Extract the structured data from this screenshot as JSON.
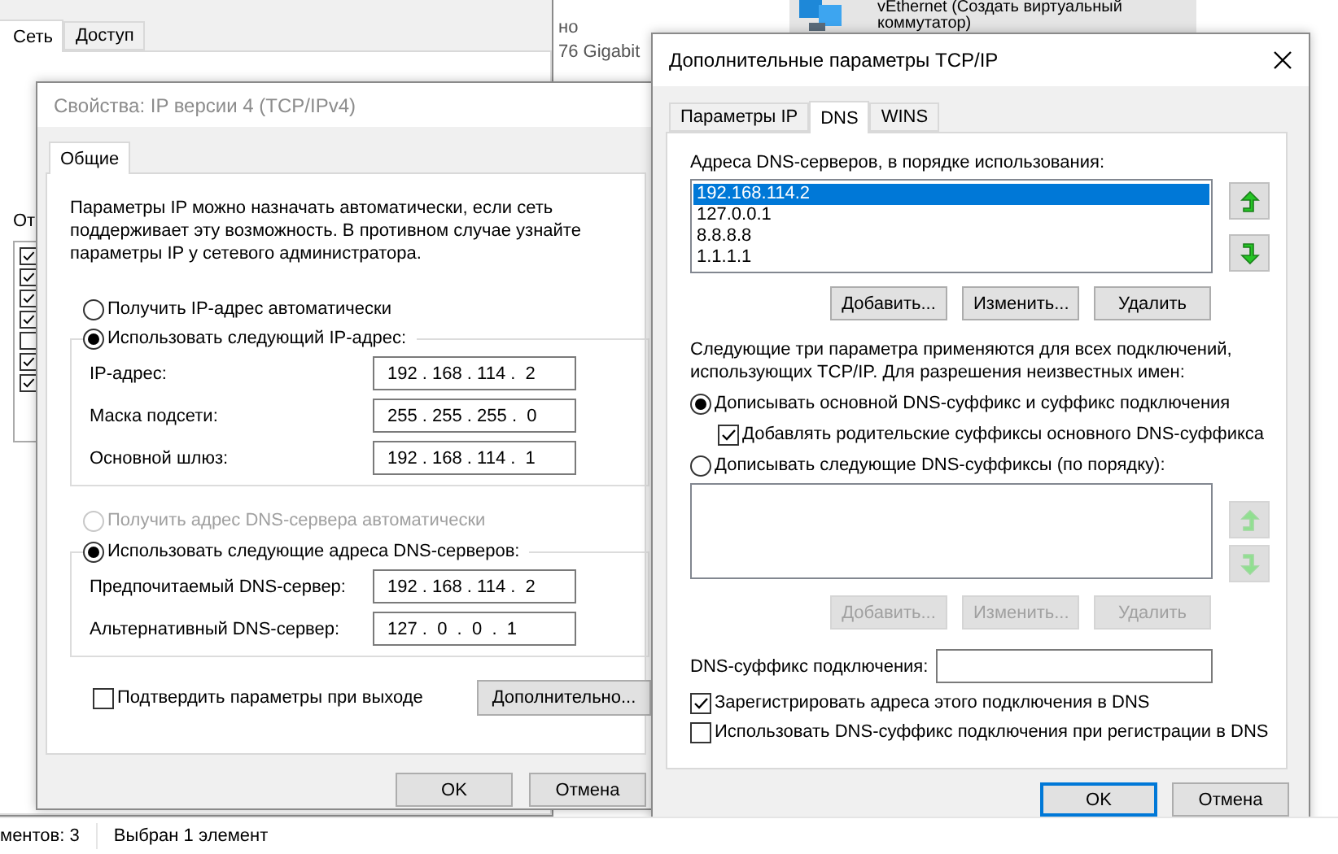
{
  "background_window": {
    "tabs": [
      {
        "label": "Сеть",
        "selected": true
      },
      {
        "label": "Доступ",
        "selected": false
      }
    ],
    "section_label": "От",
    "components": [
      {
        "checked": true
      },
      {
        "checked": true
      },
      {
        "checked": true
      },
      {
        "checked": true
      },
      {
        "checked": false
      },
      {
        "checked": true
      },
      {
        "checked": true
      }
    ]
  },
  "explorer": {
    "item_lines": [
      "но",
      "76 Gigabit"
    ],
    "adapter_lines": [
      "vEthernet (Создать виртуальный",
      "коммутатор)"
    ],
    "status_bar": [
      "ментов: 3",
      "Выбран 1 элемент"
    ]
  },
  "ipv4_dialog": {
    "title": "Свойства: IP версии 4 (TCP/IPv4)",
    "tabs": [
      {
        "label": "Общие",
        "selected": true
      }
    ],
    "description": "Параметры IP можно назначать автоматически, если сеть поддерживает эту возможность. В противном случае узнайте параметры IP у сетевого администратора.",
    "ip_auto": {
      "label": "Получить IP-адрес автоматически",
      "selected": false,
      "disabled": false
    },
    "ip_manual": {
      "label": "Использовать следующий IP-адрес:",
      "selected": true,
      "disabled": false
    },
    "ip_fields": [
      {
        "label": "IP-адрес:",
        "value": "192 . 168 . 114 .  2"
      },
      {
        "label": "Маска подсети:",
        "value": "255 . 255 . 255 .  0"
      },
      {
        "label": "Основной шлюз:",
        "value": "192 . 168 . 114 .  1"
      }
    ],
    "dns_auto": {
      "label": "Получить адрес DNS-сервера автоматически",
      "selected": false,
      "disabled": true
    },
    "dns_manual": {
      "label": "Использовать следующие адреса DNS-серверов:",
      "selected": true,
      "disabled": false
    },
    "dns_fields": [
      {
        "label": "Предпочитаемый DNS-сервер:",
        "value": "192 . 168 . 114 .  2"
      },
      {
        "label": "Альтернативный DNS-сервер:",
        "value": "127 .  0  .  0  .  1"
      }
    ],
    "confirm": {
      "label": "Подтвердить параметры при выходе",
      "checked": false
    },
    "advanced_button": "Дополнительно...",
    "buttons": [
      "OK",
      "Отмена"
    ]
  },
  "advanced_dialog": {
    "title": "Дополнительные параметры TCP/IP",
    "tabs": [
      {
        "label": "Параметры IP",
        "selected": false
      },
      {
        "label": "DNS",
        "selected": true
      },
      {
        "label": "WINS",
        "selected": false
      }
    ],
    "servers_label": "Адреса DNS-серверов, в порядке использования:",
    "servers": [
      {
        "text": "192.168.114.2",
        "selected": true
      },
      {
        "text": "127.0.0.1",
        "selected": false
      },
      {
        "text": "8.8.8.8",
        "selected": false
      },
      {
        "text": "1.1.1.1",
        "selected": false
      }
    ],
    "server_arrows_disabled": false,
    "server_buttons": [
      {
        "label": "Добавить...",
        "disabled": false
      },
      {
        "label": "Изменить...",
        "disabled": false
      },
      {
        "label": "Удалить",
        "disabled": false
      }
    ],
    "note": "Следующие три параметра применяются для всех подключений, использующих TCP/IP. Для разрешения неизвестных имен:",
    "primary_suffix": {
      "label": "Дописывать основной DNS-суффикс и суффикс подключения",
      "selected": true
    },
    "parent_suffix": {
      "label": "Добавлять родительские суффиксы основного DNS-суффикса",
      "checked": true
    },
    "listed_suffix": {
      "label": "Дописывать следующие DNS-суффиксы (по порядку):",
      "selected": false
    },
    "suffix_arrows_disabled": true,
    "suffix_buttons": [
      {
        "label": "Добавить...",
        "disabled": true
      },
      {
        "label": "Изменить...",
        "disabled": true
      },
      {
        "label": "Удалить",
        "disabled": true
      }
    ],
    "suffix_field_label": "DNS-суффикс подключения:",
    "register_options": [
      {
        "label": "Зарегистрировать адреса этого подключения в DNS",
        "checked": true
      },
      {
        "label": "Использовать DNS-суффикс подключения при регистрации в DNS",
        "checked": false
      }
    ],
    "buttons": [
      {
        "label": "OK",
        "default": true
      },
      {
        "label": "Отмена",
        "default": false
      }
    ]
  }
}
